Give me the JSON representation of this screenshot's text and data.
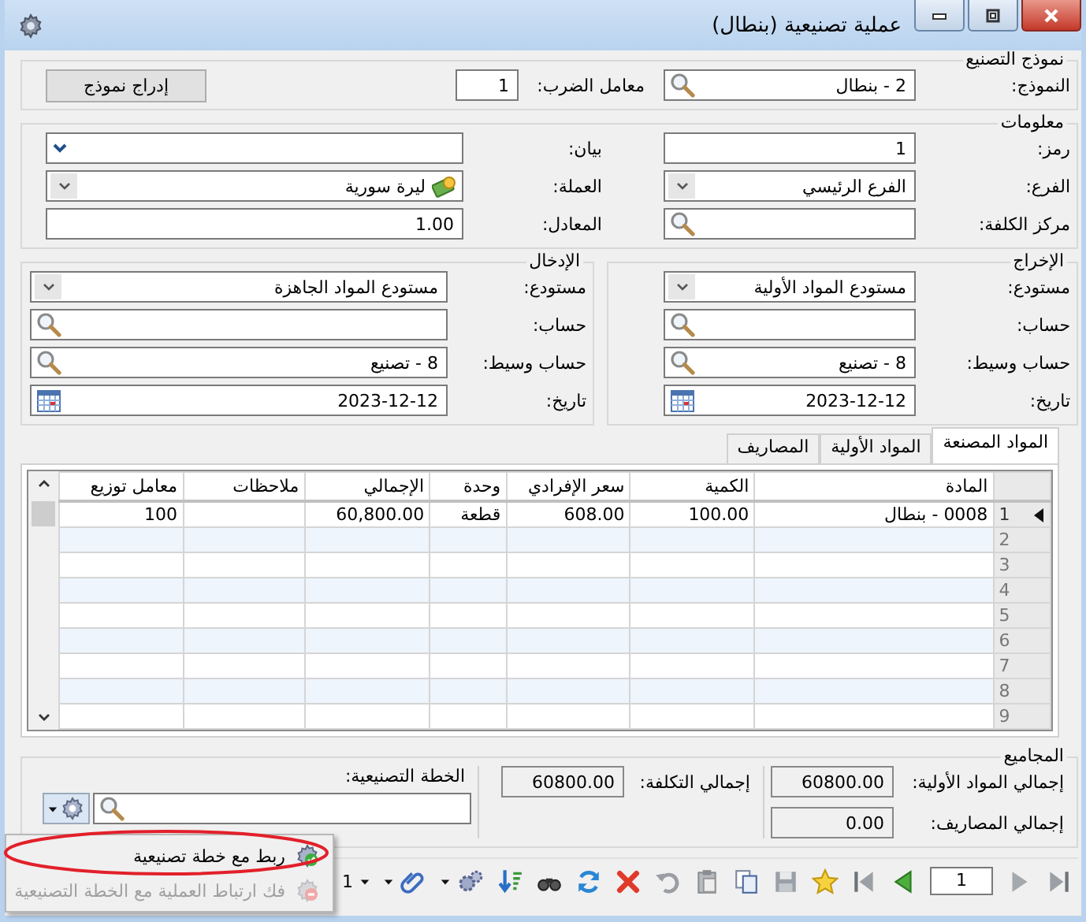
{
  "window": {
    "title": "عملية تصنيعية (بنطال)"
  },
  "template": {
    "title": "نموذج التصنيع",
    "model": {
      "label": "النموذج:",
      "value": "2 - بنطال",
      "kind": "search"
    },
    "multiplier": {
      "label": "معامل الضرب:",
      "value": "1"
    },
    "insert_button": "إدراج نموذج"
  },
  "info": {
    "title": "معلومات",
    "right": [
      {
        "label": "رمز:",
        "value": "1",
        "kind": "text"
      },
      {
        "label": "الفرع:",
        "value": "الفرع الرئيسي",
        "kind": "dropdown"
      },
      {
        "label": "مركز الكلفة:",
        "kind": "search"
      }
    ],
    "left": [
      {
        "label": "بيان:",
        "kind": "combo"
      },
      {
        "label": "العملة:",
        "value": "ليرة سورية",
        "kind": "currency"
      },
      {
        "label": "المعادل:",
        "value": "1.00",
        "kind": "text"
      }
    ]
  },
  "output": {
    "title": "الإخراج",
    "fields": [
      {
        "label": "مستودع:",
        "value": "مستودع المواد الأولية",
        "kind": "dropdown"
      },
      {
        "label": "حساب:",
        "kind": "search"
      },
      {
        "label": "حساب وسيط:",
        "value": "8 - تصنيع",
        "kind": "search"
      },
      {
        "label": "تاريخ:",
        "value": "2023-12-12",
        "kind": "date"
      }
    ]
  },
  "input": {
    "title": "الإدخال",
    "fields": [
      {
        "label": "مستودع:",
        "value": "مستودع المواد الجاهزة",
        "kind": "dropdown"
      },
      {
        "label": "حساب:",
        "kind": "search"
      },
      {
        "label": "حساب وسيط:",
        "value": "8 - تصنيع",
        "kind": "search"
      },
      {
        "label": "تاريخ:",
        "value": "2023-12-12",
        "kind": "date"
      }
    ]
  },
  "tabs": [
    {
      "label": "المواد المصنعة",
      "selected": true
    },
    {
      "label": "المواد الأولية",
      "selected": false
    },
    {
      "label": "المصاريف",
      "selected": false
    }
  ],
  "grid": {
    "columns": [
      "المادة",
      "الكمية",
      "سعر الإفرادي",
      "وحدة",
      "الإجمالي",
      "ملاحظات",
      "معامل توزيع"
    ],
    "rows": [
      {
        "number": "1",
        "selected": true,
        "cells": [
          "0008 - بنطال",
          "100.00",
          "608.00",
          "قطعة",
          "60,800.00",
          null,
          "100"
        ]
      },
      {
        "number": "2",
        "selected": false
      },
      {
        "number": "3",
        "selected": false
      },
      {
        "number": "4",
        "selected": false
      },
      {
        "number": "5",
        "selected": false
      },
      {
        "number": "6",
        "selected": false
      },
      {
        "number": "7",
        "selected": false
      },
      {
        "number": "8",
        "selected": false
      },
      {
        "number": "9",
        "selected": false
      }
    ]
  },
  "totals": {
    "title": "المجاميع",
    "raw_total": {
      "label": "إجمالي المواد الأولية:",
      "value": "60800.00",
      "kind": "readonly"
    },
    "expenses_total": {
      "label": "إجمالي المصاريف:",
      "value": "0.00",
      "kind": "readonly"
    },
    "cost_total": {
      "label": "إجمالي التكلفة:",
      "value": "60800.00",
      "kind": "readonly"
    },
    "plan": {
      "label": "الخطة التصنيعية:",
      "kind": "search"
    }
  },
  "menu": {
    "items": [
      {
        "label": "ربط مع خطة تصنيعية",
        "disabled": false
      },
      {
        "label": "فك ارتباط العملية مع الخطة التصنيعية",
        "disabled": true
      }
    ]
  },
  "toolbar": {
    "page": "1",
    "count": "1"
  }
}
